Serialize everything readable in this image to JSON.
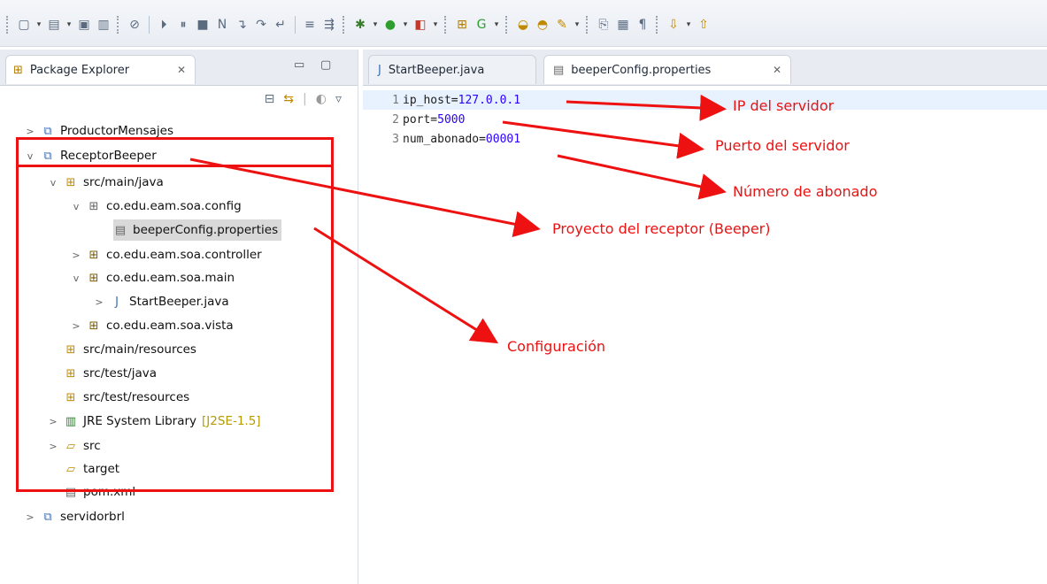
{
  "toolbar": {
    "icons": [
      "new-icon",
      "new-wizard-icon",
      "save-icon",
      "save-all-icon",
      "skip-breakpoints-icon",
      "resume-icon",
      "suspend-icon",
      "terminate-icon",
      "disconnect-icon",
      "step-into-icon",
      "step-over-icon",
      "step-return-icon",
      "drop-to-frame-icon",
      "use-step-filters-icon",
      "debug-icon",
      "run-icon",
      "external-tools-icon",
      "new-java-project-icon",
      "new-java-class-icon",
      "open-type-icon",
      "open-task-icon",
      "search-icon",
      "toggle-mark-icon",
      "block-selection-icon",
      "show-whitespace-icon",
      "next-annotation-icon",
      "previous-annotation-icon"
    ]
  },
  "package_explorer": {
    "tab_label": "Package Explorer",
    "tab_close": "✕",
    "tree": [
      {
        "label": "ProductorMensajes",
        "type": "project",
        "arrow": ">"
      },
      {
        "label": "ReceptorBeeper",
        "type": "project",
        "arrow": "v"
      },
      {
        "label": "src/main/java",
        "type": "source-folder",
        "arrow": "v"
      },
      {
        "label": "co.edu.eam.soa.config",
        "type": "package",
        "arrow": "v"
      },
      {
        "label": "beeperConfig.properties",
        "type": "file",
        "arrow": ""
      },
      {
        "label": "co.edu.eam.soa.controller",
        "type": "package",
        "arrow": ">"
      },
      {
        "label": "co.edu.eam.soa.main",
        "type": "package",
        "arrow": "v"
      },
      {
        "label": "StartBeeper.java",
        "type": "java",
        "arrow": ">"
      },
      {
        "label": "co.edu.eam.soa.vista",
        "type": "package",
        "arrow": ">"
      },
      {
        "label": "src/main/resources",
        "type": "source-folder",
        "arrow": ""
      },
      {
        "label": "src/test/java",
        "type": "source-folder",
        "arrow": ""
      },
      {
        "label": "src/test/resources",
        "type": "source-folder",
        "arrow": ""
      },
      {
        "label": "JRE System Library",
        "decor": "[J2SE-1.5]",
        "type": "library",
        "arrow": ">"
      },
      {
        "label": "src",
        "type": "folder",
        "arrow": ">"
      },
      {
        "label": "target",
        "type": "folder",
        "arrow": ""
      },
      {
        "label": "pom.xml",
        "type": "file",
        "arrow": ""
      },
      {
        "label": "servidorbrl",
        "type": "project",
        "arrow": ">"
      }
    ]
  },
  "editor": {
    "tabs": [
      {
        "label": "StartBeeper.java",
        "active": false
      },
      {
        "label": "beeperConfig.properties",
        "active": true,
        "close": "✕"
      }
    ],
    "lines": [
      {
        "n": "1",
        "key": "ip_host=",
        "value": "127.0.0.1"
      },
      {
        "n": "2",
        "key": "port=",
        "value": "5000"
      },
      {
        "n": "3",
        "key": "num_abonado=",
        "value": "00001"
      }
    ]
  },
  "annotations": {
    "ip": "IP del servidor",
    "port": "Puerto del servidor",
    "abonado": "Número de abonado",
    "project": "Proyecto del receptor (Beeper)",
    "config": "Configuración",
    "color": "#ee1111"
  }
}
